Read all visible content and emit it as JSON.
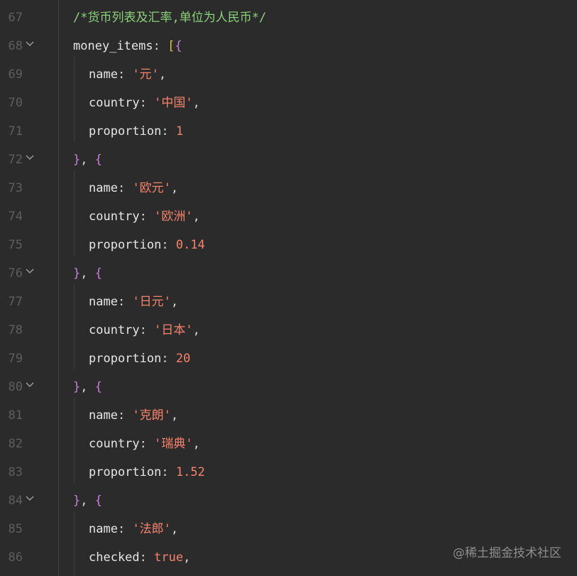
{
  "lines": [
    {
      "n": "67",
      "comment": "/*货币列表及汇率,单位为人民币*/"
    },
    {
      "n": "68",
      "key": "money_items",
      "sep": ": ",
      "open_bracket": "[",
      "open_brace": "{"
    },
    {
      "n": "69",
      "key": "name",
      "sep": ": ",
      "str": "'元'",
      "end": ","
    },
    {
      "n": "70",
      "key": "country",
      "sep": ": ",
      "str": "'中国'",
      "end": ","
    },
    {
      "n": "71",
      "key": "proportion",
      "sep": ": ",
      "num": "1"
    },
    {
      "n": "72",
      "close_brace": "}",
      "comma": ", ",
      "open_brace": "{"
    },
    {
      "n": "73",
      "key": "name",
      "sep": ": ",
      "str": "'欧元'",
      "end": ","
    },
    {
      "n": "74",
      "key": "country",
      "sep": ": ",
      "str": "'欧洲'",
      "end": ","
    },
    {
      "n": "75",
      "key": "proportion",
      "sep": ": ",
      "num": "0.14"
    },
    {
      "n": "76",
      "close_brace": "}",
      "comma": ", ",
      "open_brace": "{"
    },
    {
      "n": "77",
      "key": "name",
      "sep": ": ",
      "str": "'日元'",
      "end": ","
    },
    {
      "n": "78",
      "key": "country",
      "sep": ": ",
      "str": "'日本'",
      "end": ","
    },
    {
      "n": "79",
      "key": "proportion",
      "sep": ": ",
      "num": "20"
    },
    {
      "n": "80",
      "close_brace": "}",
      "comma": ", ",
      "open_brace": "{"
    },
    {
      "n": "81",
      "key": "name",
      "sep": ": ",
      "str": "'克朗'",
      "end": ","
    },
    {
      "n": "82",
      "key": "country",
      "sep": ": ",
      "str": "'瑞典'",
      "end": ","
    },
    {
      "n": "83",
      "key": "proportion",
      "sep": ": ",
      "num": "1.52"
    },
    {
      "n": "84",
      "close_brace": "}",
      "comma": ", ",
      "open_brace": "{"
    },
    {
      "n": "85",
      "key": "name",
      "sep": ": ",
      "str": "'法郎'",
      "end": ","
    },
    {
      "n": "86",
      "key": "checked",
      "sep": ": ",
      "bool": "true",
      "end": ","
    }
  ],
  "watermark": "@稀土掘金技术社区",
  "colors": {
    "background": "#2b2b2b",
    "comment": "#8ad27a",
    "string": "#f7836b",
    "brace": "#c77fd8",
    "bracket": "#e7c14c",
    "line_number": "#5e5e5e"
  },
  "fold_icon": "chevron-down-icon"
}
